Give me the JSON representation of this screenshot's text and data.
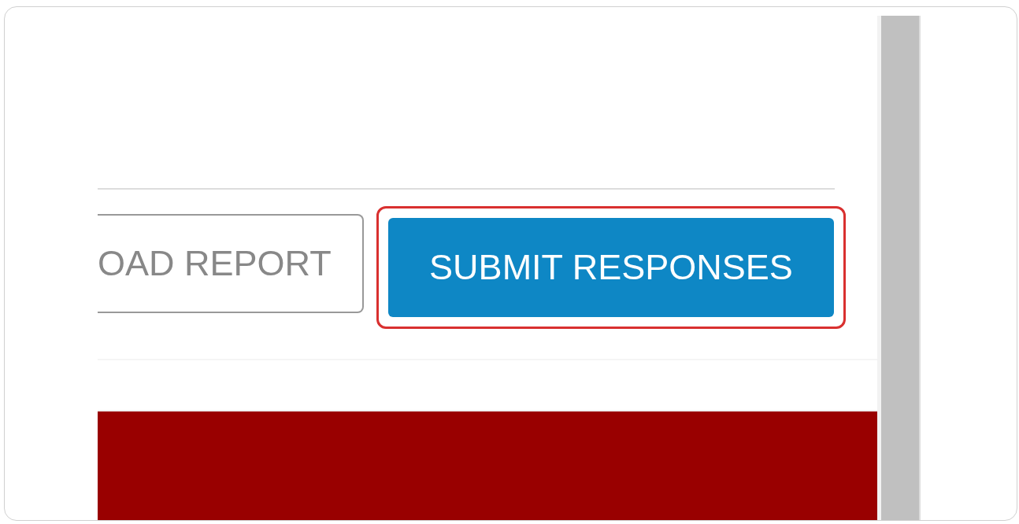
{
  "buttons": [
    {
      "label": "OAD REPORT",
      "kind": "outline",
      "highlighted": false
    },
    {
      "label": "SUBMIT RESPONSES",
      "kind": "primary",
      "highlighted": true
    }
  ]
}
